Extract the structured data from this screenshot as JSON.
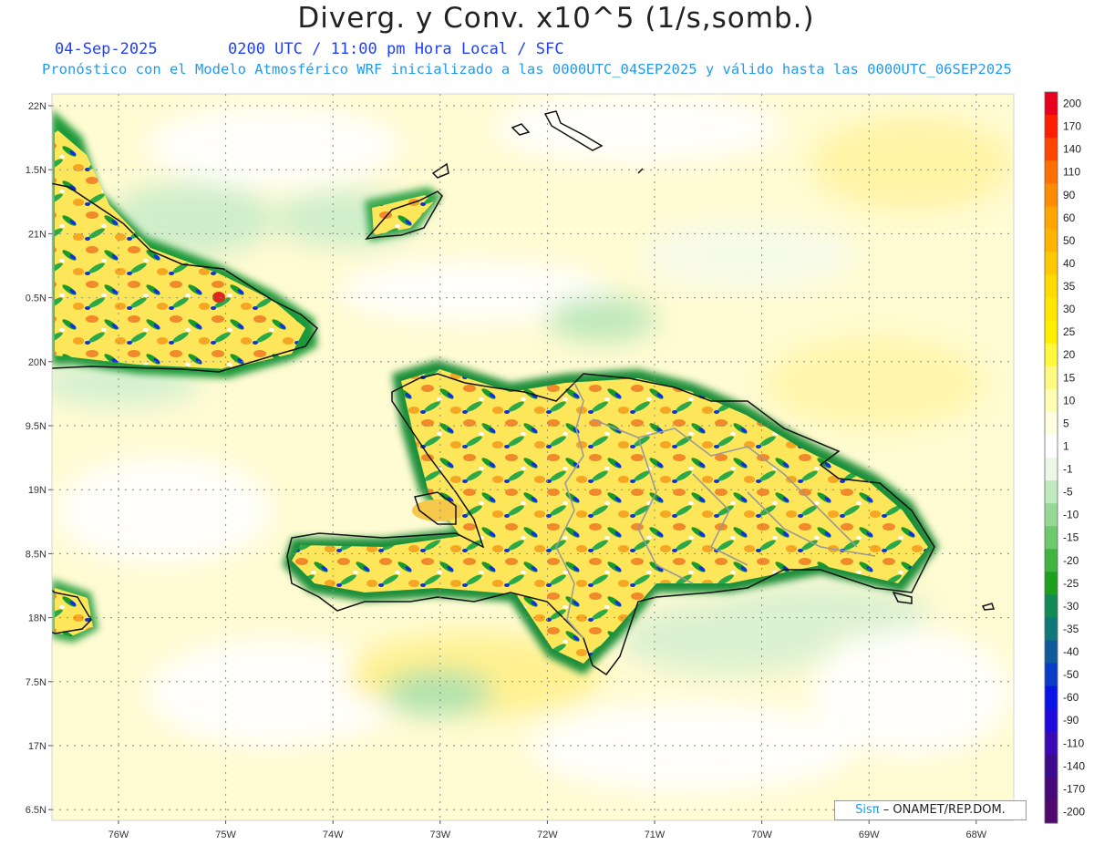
{
  "title": "Diverg. y Conv. x10^5 (1/s,somb.)",
  "subtitle": {
    "date": "04-Sep-2025",
    "time": "0200 UTC / 11:00 pm Hora Local / SFC",
    "forecast": "Pronóstico con el Modelo Atmosférico WRF inicializado a las 0000UTC_04SEP2025 y válido hasta las  0000UTC_06SEP2025"
  },
  "map": {
    "lat_labels": [
      "22N",
      "1.5N",
      "21N",
      "0.5N",
      "20N",
      "9.5N",
      "19N",
      "8.5N",
      "18N",
      "7.5N",
      "17N",
      "6.5N"
    ],
    "lon_labels": [
      "76W",
      "75W",
      "74W",
      "73W",
      "72W",
      "71W",
      "70W",
      "69W",
      "68W"
    ]
  },
  "colorbar": {
    "labels": [
      "200",
      "170",
      "140",
      "110",
      "90",
      "60",
      "50",
      "40",
      "35",
      "30",
      "25",
      "20",
      "15",
      "10",
      "5",
      "1",
      "-1",
      "-5",
      "-10",
      "-15",
      "-20",
      "-25",
      "-30",
      "-35",
      "-40",
      "-50",
      "-60",
      "-90",
      "-110",
      "-140",
      "-170",
      "-200"
    ],
    "colors": [
      "#e8001e",
      "#ff1e00",
      "#ff4600",
      "#ff6e00",
      "#ff8c00",
      "#ffa500",
      "#ffb400",
      "#ffc800",
      "#ffdc00",
      "#ffe800",
      "#fff000",
      "#fff83c",
      "#fffa82",
      "#fffcb4",
      "#fffee0",
      "#ffffff",
      "#ecf8e6",
      "#bfe9bf",
      "#96d996",
      "#6cc96c",
      "#40b440",
      "#1ea01e",
      "#118a55",
      "#0f7878",
      "#0f5a9a",
      "#0a3cc8",
      "#0a14e6",
      "#1e0adc",
      "#3c0ab4",
      "#3c0a8c",
      "#460a78",
      "#500a6e"
    ]
  },
  "credit": {
    "brand": "Sisπ",
    "text": "– ONAMET/REP.DOM."
  }
}
